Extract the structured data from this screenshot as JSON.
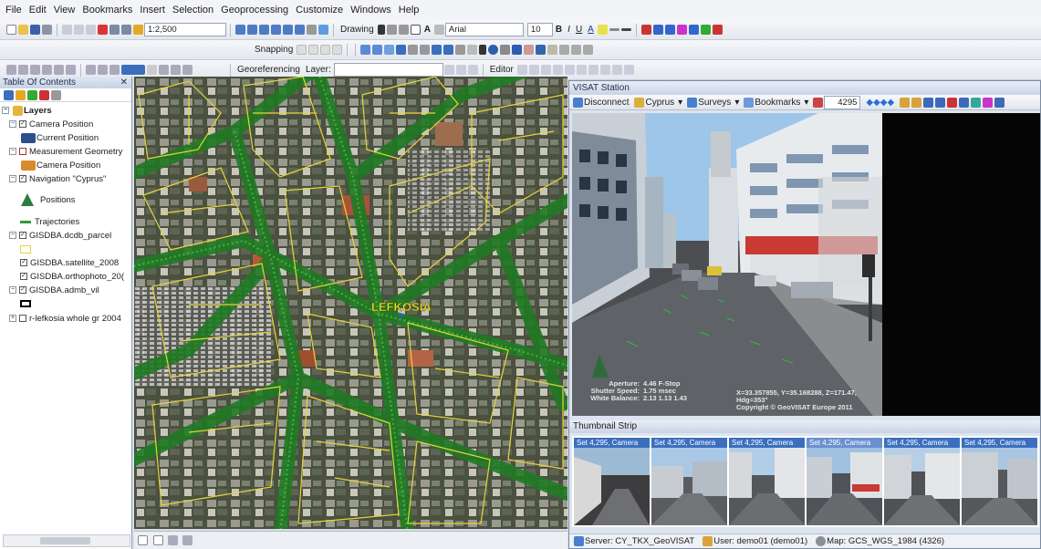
{
  "menubar": [
    "File",
    "Edit",
    "View",
    "Bookmarks",
    "Insert",
    "Selection",
    "Geoprocessing",
    "Customize",
    "Windows",
    "Help"
  ],
  "toolbar1": {
    "scale": "1:2,500",
    "drawing_label": "Drawing",
    "font_name": "Arial",
    "font_size": "10"
  },
  "toolbar2": {
    "snapping_label": "Snapping"
  },
  "toolbar3": {
    "georeferencing_label": "Georeferencing",
    "layer_label": "Layer:",
    "editor_label": "Editor"
  },
  "toc": {
    "title": "Table Of Contents",
    "items": [
      {
        "label": "Layers"
      },
      {
        "label": "Camera Position"
      },
      {
        "label": "Current Position"
      },
      {
        "label": "Measurement Geometry"
      },
      {
        "label": "Camera Position"
      },
      {
        "label": "Navigation \"Cyprus\""
      },
      {
        "label": "Positions"
      },
      {
        "label": "Trajectories"
      },
      {
        "label": "GISDBA.dcdb_parcel"
      },
      {
        "label": "GISDBA.satellite_2008"
      },
      {
        "label": "GISDBA.orthophoto_20("
      },
      {
        "label": "GISDBA.admb_vil"
      },
      {
        "label": "r-lefkosia whole gr 2004"
      }
    ]
  },
  "map": {
    "place_label": "LEFKOSIA"
  },
  "visat": {
    "title": "VISAT Station",
    "disconnect": "Disconnect",
    "cyprus": "Cyprus",
    "surveys": "Surveys",
    "bookmarks": "Bookmarks",
    "frame": "4295",
    "info_left": [
      "Aperture:",
      "Shutter Speed:",
      "White Balance:"
    ],
    "info_left_vals": [
      "4.46 F-Stop",
      "1.75 msec",
      "2.13  1.13  1.43"
    ],
    "info_right": [
      "X=33.357855, Y=35.168288, Z=171.47, Hdg=353°",
      "Copyright © GeoVISAT Europe 2011"
    ],
    "thumb_title": "Thumbnail Strip",
    "thumbs": [
      "Set 4,295, Camera",
      "Set 4,295, Camera",
      "Set 4,295, Camera",
      "Set 4,295, Camera",
      "Set 4,295, Camera",
      "Set 4,295, Camera"
    ],
    "status_server": "Server: CY_TKX_GeoVISAT",
    "status_user": "User: demo01 (demo01)",
    "status_map": "Map: GCS_WGS_1984 (4326)"
  },
  "colors": {
    "accent": "#3b6fbe",
    "road": "#1f7a23",
    "parcel": "#e6d43a",
    "label": "#f0e62a"
  }
}
